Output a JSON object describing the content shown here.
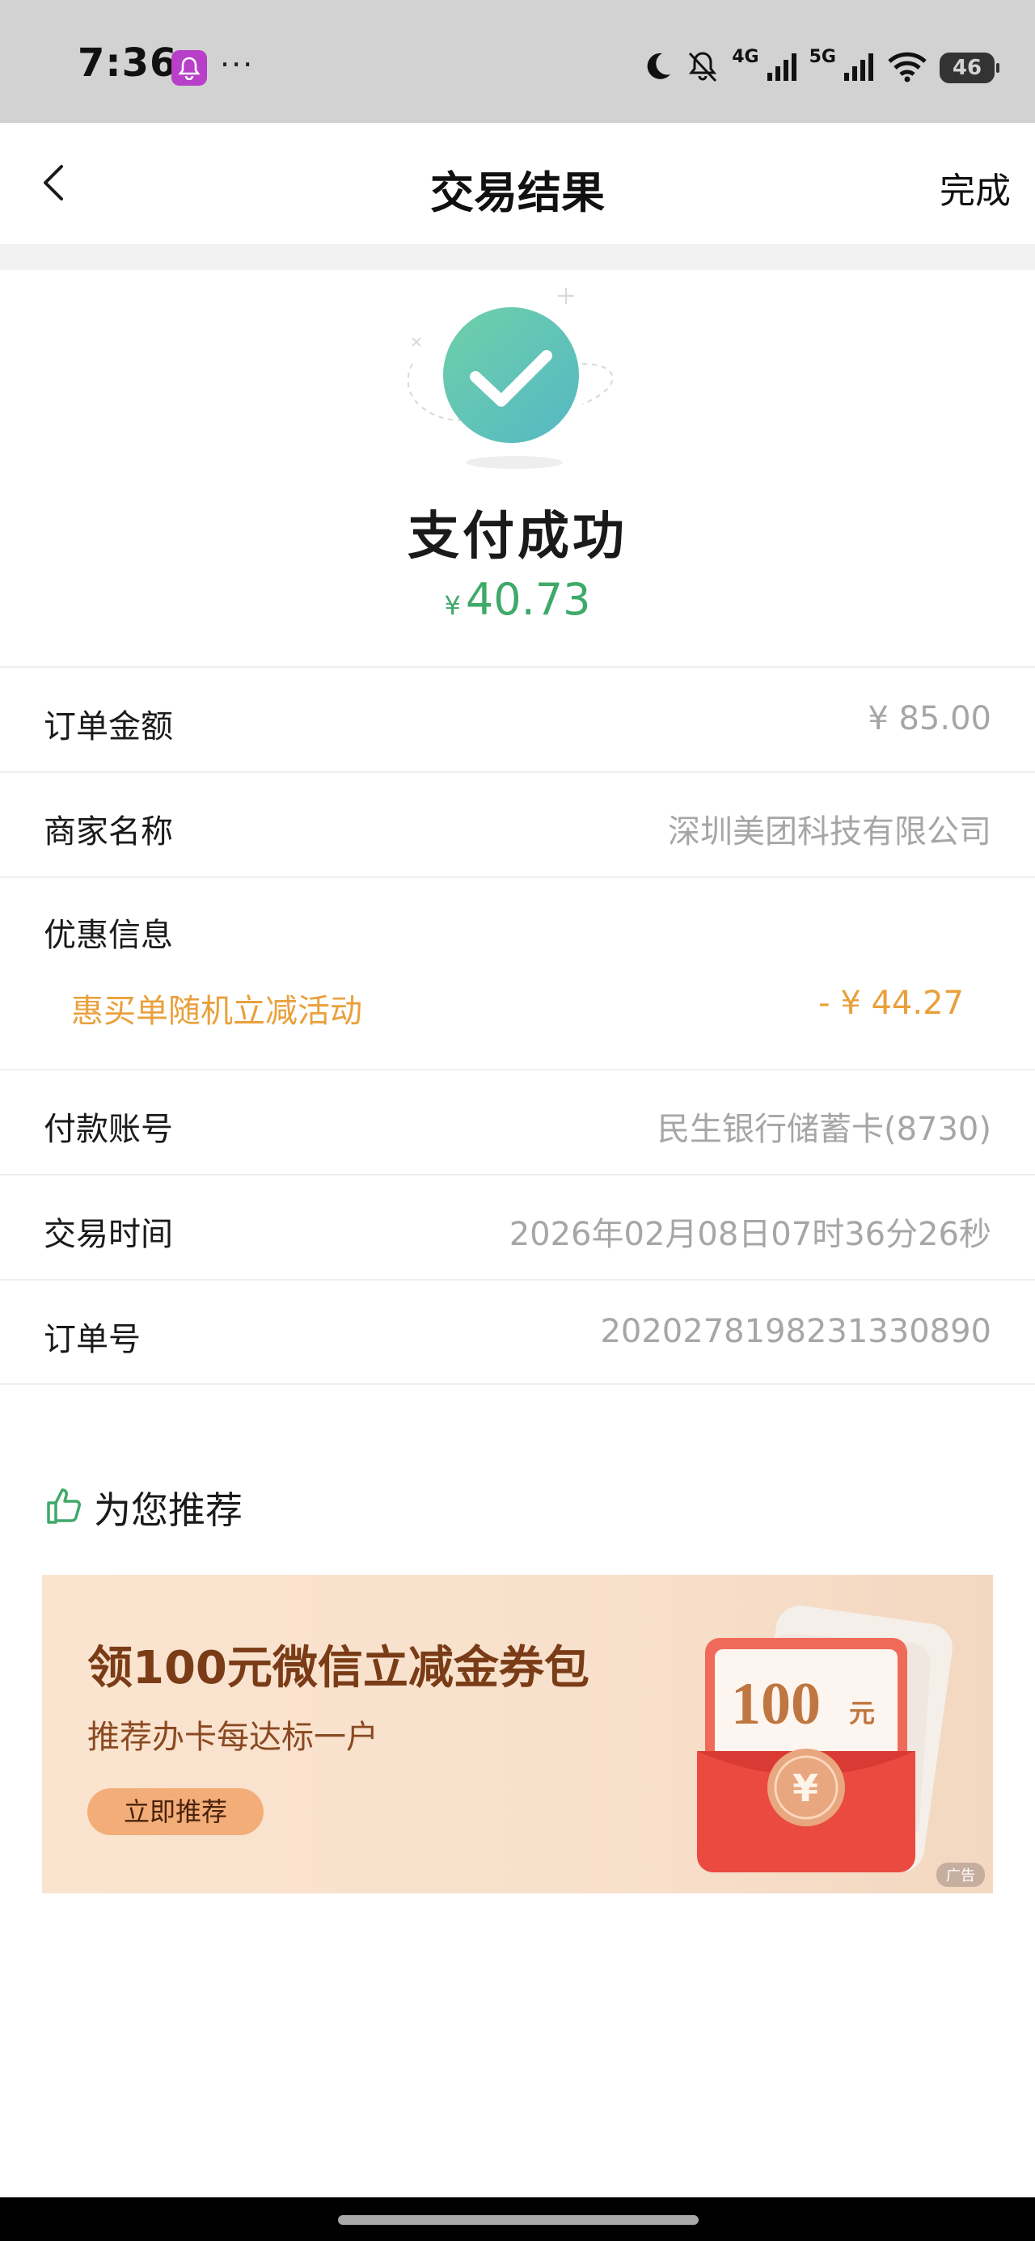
{
  "status_bar": {
    "time": "7:36",
    "more": "···",
    "net_4g": "4G",
    "net_5g": "5G",
    "battery": "46",
    "icons": [
      "bell-app-icon",
      "moon-icon",
      "mute-icon",
      "signal-icon",
      "wifi-icon",
      "battery-icon"
    ]
  },
  "header": {
    "title": "交易结果",
    "done_label": "完成"
  },
  "result": {
    "title": "支付成功",
    "currency": "¥",
    "amount": "40.73",
    "amount_color": "#3fa96a"
  },
  "details": {
    "order_amount": {
      "label": "订单金额",
      "value": "¥ 85.00"
    },
    "merchant": {
      "label": "商家名称",
      "value": "深圳美团科技有限公司"
    },
    "discount": {
      "label": "优惠信息",
      "name": "惠买单随机立减活动",
      "value": "- ¥ 44.27",
      "color": "#e9a03b"
    },
    "account": {
      "label": "付款账号",
      "value": "民生银行储蓄卡(8730)"
    },
    "time": {
      "label": "交易时间",
      "value": "2026年02月08日07时36分26秒"
    },
    "order_no": {
      "label": "订单号",
      "value": "2020278198231330890"
    }
  },
  "recommend": {
    "title": "为您推荐",
    "ad": {
      "title": "领100元微信立减金券包",
      "subtitle": "推荐办卡每达标一户",
      "button": "立即推荐",
      "tag": "广告",
      "coupon_amount": "100",
      "coupon_unit": "元",
      "coin_symbol": "¥"
    }
  }
}
